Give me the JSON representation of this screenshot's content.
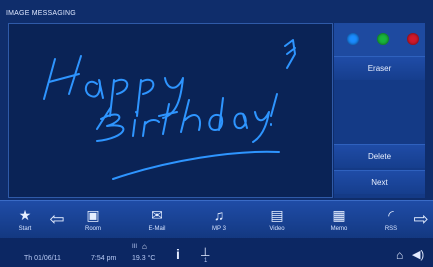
{
  "window": {
    "title": "IMAGE MESSAGING"
  },
  "canvas": {
    "drawing_text": "Happy Birthday!",
    "ink_color": "#2e95ff"
  },
  "colors": [
    {
      "name": "blue",
      "hex": "#1a8cff",
      "selected": true
    },
    {
      "name": "green",
      "hex": "#19b63b",
      "selected": false
    },
    {
      "name": "red",
      "hex": "#d2192a",
      "selected": false
    }
  ],
  "panel": {
    "eraser_label": "Eraser",
    "delete_label": "Delete",
    "next_label": "Next"
  },
  "toolbar": {
    "items": [
      {
        "icon": "star-icon",
        "label": "Start"
      },
      {
        "icon": "room-icon",
        "label": "Room"
      },
      {
        "icon": "email-icon",
        "label": "E-Mail"
      },
      {
        "icon": "music-icon",
        "label": "MP 3"
      },
      {
        "icon": "video-icon",
        "label": "Video"
      },
      {
        "icon": "memo-icon",
        "label": "Memo"
      },
      {
        "icon": "rss-icon",
        "label": "RSS"
      }
    ]
  },
  "status": {
    "date": "Th 01/06/11",
    "time": "7:54 pm",
    "temperature": "19.3 °C",
    "temp_label": "III",
    "pin_count": "1"
  }
}
